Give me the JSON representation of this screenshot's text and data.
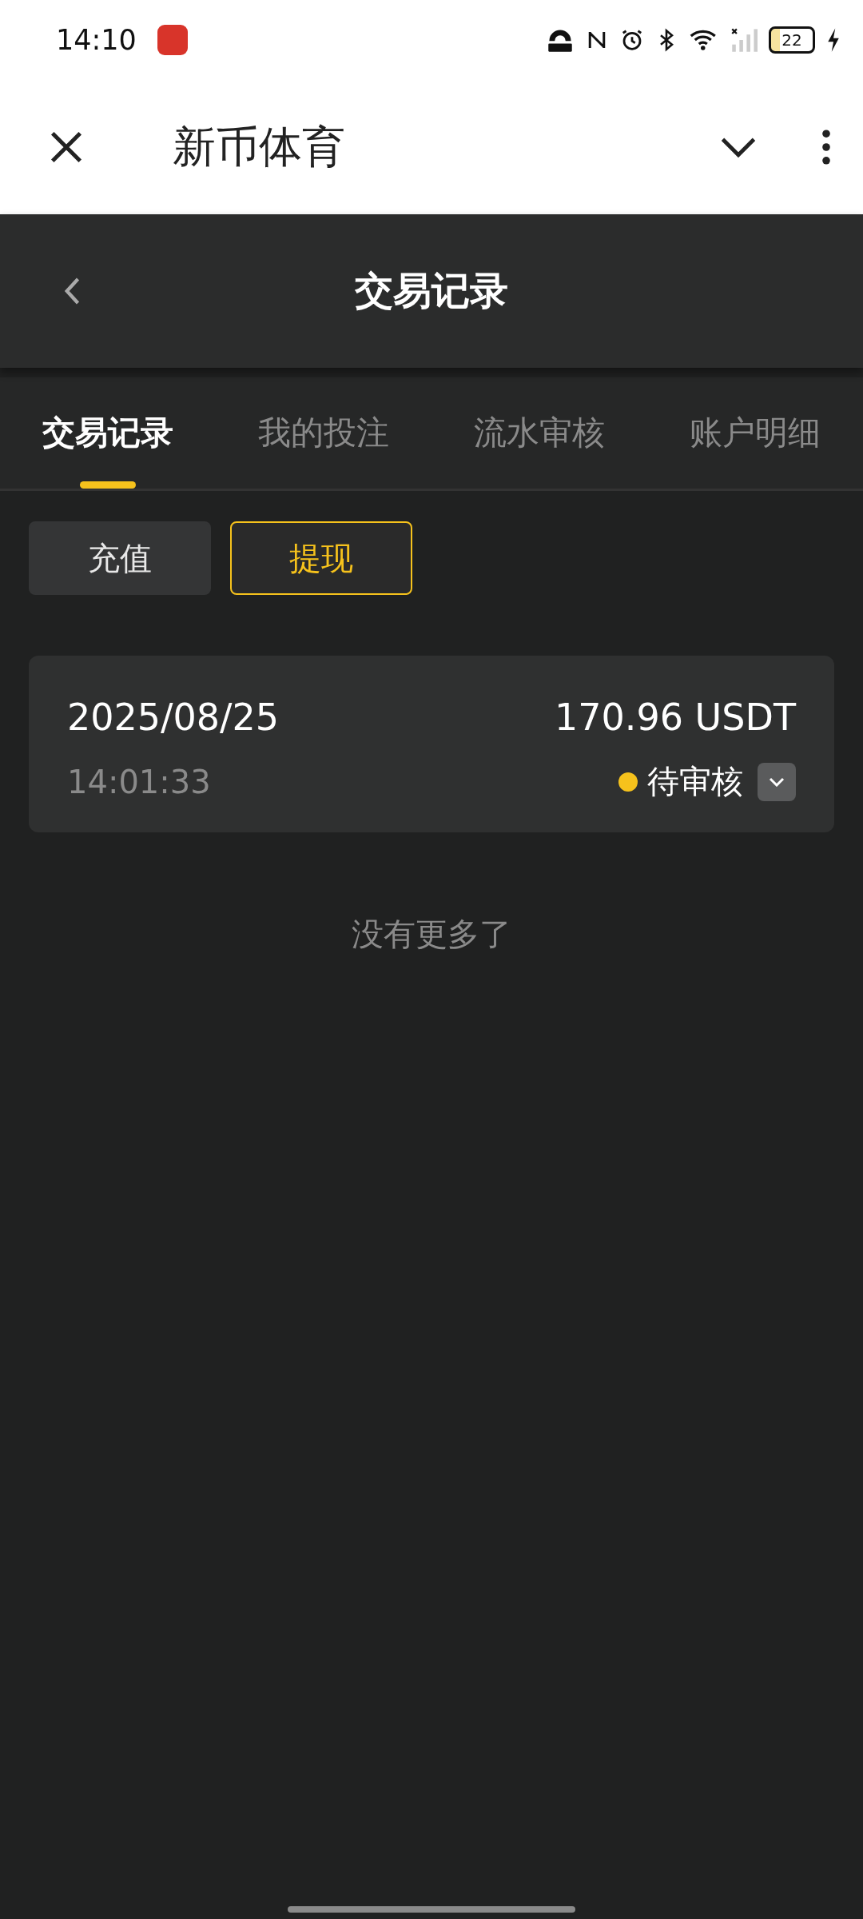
{
  "status_bar": {
    "time": "14:10",
    "battery": "22"
  },
  "browser": {
    "title": "新币体育"
  },
  "header": {
    "title": "交易记录"
  },
  "tabs": [
    {
      "label": "交易记录",
      "selected": true
    },
    {
      "label": "我的投注",
      "selected": false
    },
    {
      "label": "流水审核",
      "selected": false
    },
    {
      "label": "账户明细",
      "selected": false
    }
  ],
  "filters": [
    {
      "label": "充值",
      "selected": false
    },
    {
      "label": "提现",
      "selected": true
    }
  ],
  "records": [
    {
      "date": "2025/08/25",
      "time": "14:01:33",
      "amount": "170.96 USDT",
      "status": "待审核",
      "color": "#f6c21c",
      "expanded": false
    }
  ],
  "footer": "没有更多了"
}
